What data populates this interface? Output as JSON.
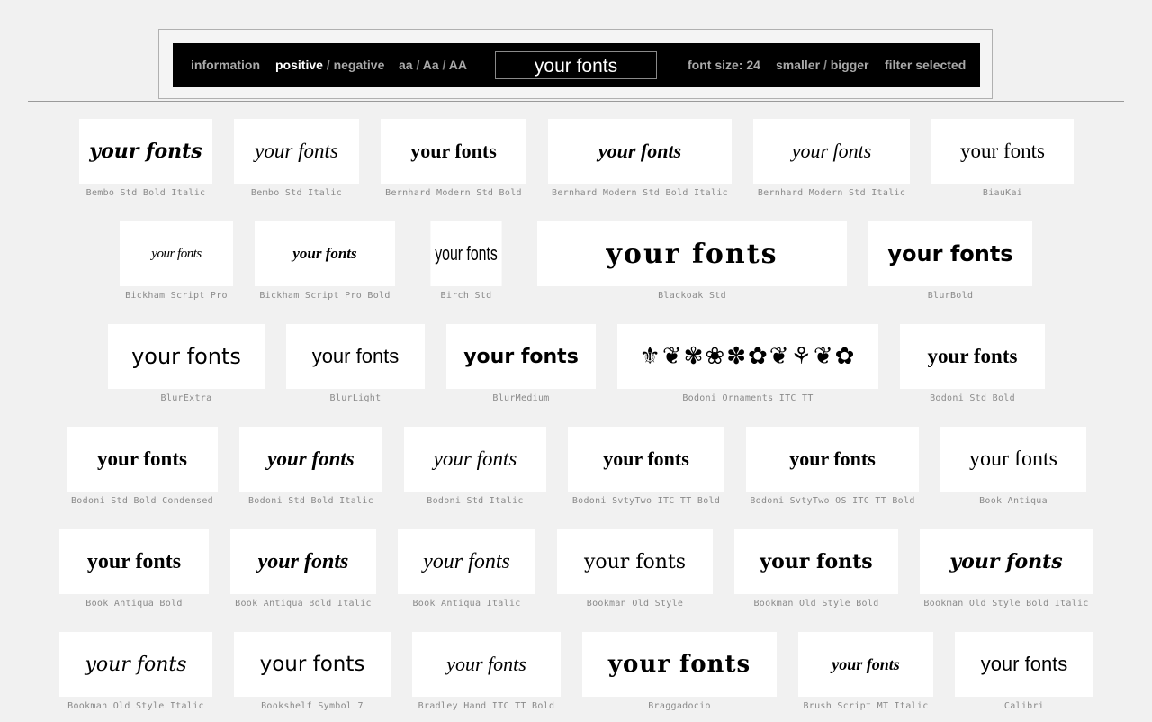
{
  "toolbar": {
    "information": "information",
    "positive": "positive",
    "slash": "/",
    "negative": "negative",
    "case_lower": "aa",
    "case_title": "Aa",
    "case_upper": "AA",
    "preview_text": "your fonts",
    "font_size_label": "font size:",
    "font_size_value": "24",
    "smaller": "smaller",
    "bigger": "bigger",
    "filter": "filter selected"
  },
  "fonts": [
    {
      "name": "Bembo Std Bold Italic",
      "sample": "your fonts"
    },
    {
      "name": "Bembo Std Italic",
      "sample": "your fonts"
    },
    {
      "name": "Bernhard Modern Std Bold",
      "sample": "your fonts"
    },
    {
      "name": "Bernhard Modern Std Bold Italic",
      "sample": "your fonts"
    },
    {
      "name": "Bernhard Modern Std Italic",
      "sample": "your fonts"
    },
    {
      "name": "BiauKai",
      "sample": "your fonts"
    },
    {
      "name": "Bickham Script Pro",
      "sample": "your fonts"
    },
    {
      "name": "Bickham Script Pro Bold",
      "sample": "your fonts"
    },
    {
      "name": "Birch Std",
      "sample": "your fonts"
    },
    {
      "name": "Blackoak Std",
      "sample": "your fonts"
    },
    {
      "name": "BlurBold",
      "sample": "your fonts"
    },
    {
      "name": "BlurExtra",
      "sample": "your fonts"
    },
    {
      "name": "BlurLight",
      "sample": "your fonts"
    },
    {
      "name": "BlurMedium",
      "sample": "your fonts"
    },
    {
      "name": "Bodoni Ornaments ITC TT",
      "sample": "⚜❦✾❀✽✿❦⚘❦✿"
    },
    {
      "name": "Bodoni Std Bold",
      "sample": "your fonts"
    },
    {
      "name": "Bodoni Std Bold Condensed",
      "sample": "your fonts"
    },
    {
      "name": "Bodoni Std Bold Italic",
      "sample": "your fonts"
    },
    {
      "name": "Bodoni Std Italic",
      "sample": "your fonts"
    },
    {
      "name": "Bodoni SvtyTwo ITC TT Bold",
      "sample": "your fonts"
    },
    {
      "name": "Bodoni SvtyTwo OS ITC TT Bold",
      "sample": "your fonts"
    },
    {
      "name": "Book Antiqua",
      "sample": "your fonts"
    },
    {
      "name": "Book Antiqua Bold",
      "sample": "your fonts"
    },
    {
      "name": "Book Antiqua Bold Italic",
      "sample": "your fonts"
    },
    {
      "name": "Book Antiqua Italic",
      "sample": "your fonts"
    },
    {
      "name": "Bookman Old Style",
      "sample": "your fonts"
    },
    {
      "name": "Bookman Old Style Bold",
      "sample": "your fonts"
    },
    {
      "name": "Bookman Old Style Bold Italic",
      "sample": "your fonts"
    },
    {
      "name": "Bookman Old Style Italic",
      "sample": "your fonts"
    },
    {
      "name": "Bookshelf Symbol 7",
      "sample": "your fonts"
    },
    {
      "name": "Bradley Hand ITC TT Bold",
      "sample": "your fonts"
    },
    {
      "name": "Braggadocio",
      "sample": "your fonts"
    },
    {
      "name": "Brush Script MT Italic",
      "sample": "your fonts"
    },
    {
      "name": "Calibri",
      "sample": "your fonts"
    }
  ]
}
